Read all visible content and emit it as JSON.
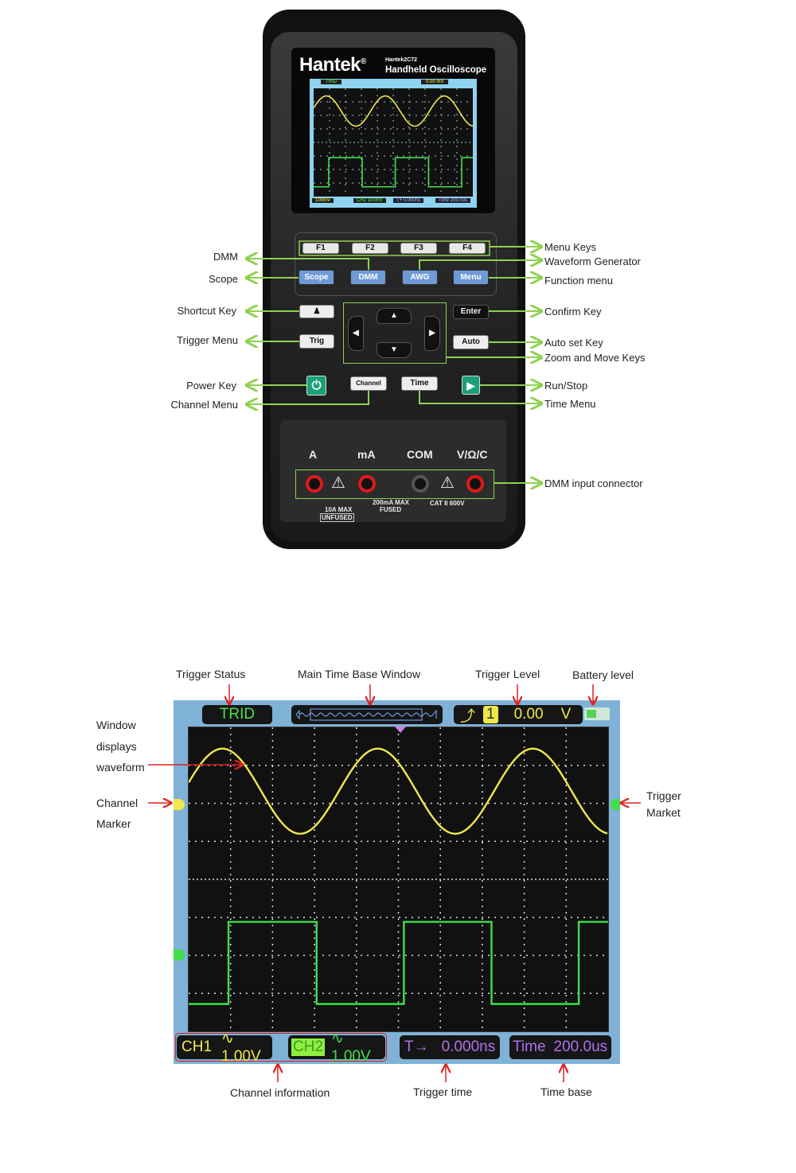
{
  "device": {
    "brand": "Hantek",
    "registered": "®",
    "model": "Hantek2C72",
    "subtitle": "Handheld Oscilloscope",
    "lcd": {
      "status": "TRID",
      "trig_level": "0.00 mV",
      "ch1": "100mV",
      "ch2": "CH2 100mV",
      "trig_time": "T+ 0.000ns",
      "time_base": "Time 200.0us"
    },
    "keys": {
      "f1": "F1",
      "f2": "F2",
      "f3": "F3",
      "f4": "F4",
      "scope": "Scope",
      "dmm": "DMM",
      "awg": "AWG",
      "menu": "Menu",
      "enter": "Enter",
      "trig": "Trig",
      "auto": "Auto",
      "channel": "Channel",
      "time": "Time"
    },
    "jacks": {
      "a": "A",
      "ma": "mA",
      "com": "COM",
      "v": "V/Ω/C",
      "a_note1": "10A MAX",
      "a_note2": "UNFUSED",
      "ma_note1": "200mA MAX",
      "ma_note2": "FUSED",
      "cat": "CAT II 600V"
    }
  },
  "callouts_left": [
    "DMM",
    "Scope",
    "Shortcut Key",
    "Trigger  Menu",
    "Power Key",
    "Channel Menu"
  ],
  "callouts_right": [
    "Menu Keys",
    "Waveform Generator",
    "Function menu",
    "Confirm Key",
    "Auto set Key",
    "Zoom and Move Keys",
    "Run/Stop",
    "Time Menu",
    "DMM input connector"
  ],
  "screen": {
    "trigger_status": "TRID",
    "trigger_channel": "1",
    "trigger_level": "0.00",
    "trigger_unit": "V",
    "ch1_label": "CH1",
    "ch1_value": "∿ 1.00V",
    "ch2_label": "CH2",
    "ch2_value": "∿ 1.00V",
    "trigger_time_label": "T→",
    "trigger_time": "0.000ns",
    "time_base_label": "Time",
    "time_base": "200.0us",
    "battery_level": 0.5,
    "colors": {
      "ch1": "#f0e84a",
      "ch2": "#3ee04a",
      "time": "#b070f0",
      "callout_arrow": "#e02020",
      "device_callout": "#8fd14f"
    }
  },
  "screen_callouts": {
    "trigger_status": "Trigger Status",
    "main_time_base": "Main Time  Base Window",
    "trigger_level": "Trigger Level",
    "battery": "Battery level",
    "window_line1": "Window",
    "window_line2": "displays",
    "window_line3": "waveform",
    "channel_marker1": "Channel",
    "channel_marker2": "Marker",
    "trigger_market1": "Trigger",
    "trigger_market2": "Market",
    "channel_info": "Channel  information",
    "trigger_time": "Trigger time",
    "time_base": "Time base"
  }
}
